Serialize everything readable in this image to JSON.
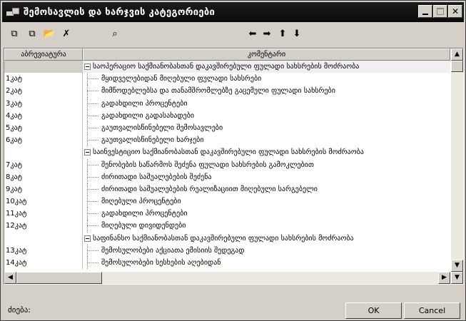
{
  "window": {
    "title": "შემოსავლის და ხარჯვის კატეგორიები",
    "minimize_label": "",
    "maximize_label": "",
    "close_label": "✕"
  },
  "toolbar": {
    "buttons": [
      {
        "name": "new-icon",
        "glyph": "⧉"
      },
      {
        "name": "edit-icon",
        "glyph": "⧉"
      },
      {
        "name": "open-folder-icon",
        "glyph": "📂"
      },
      {
        "name": "delete-icon",
        "glyph": "✗"
      },
      {
        "name": "find-icon",
        "glyph": "⌕"
      },
      {
        "name": "arrow-left-icon",
        "glyph": "⬅"
      },
      {
        "name": "arrow-right-icon",
        "glyph": "➡"
      },
      {
        "name": "arrow-up-icon",
        "glyph": "⬆"
      },
      {
        "name": "arrow-down-icon",
        "glyph": "⬇"
      }
    ]
  },
  "grid": {
    "columns": [
      "აბრევიატურა",
      "კომენტარი"
    ],
    "rows": [
      {
        "type": "group",
        "code": "",
        "name": "საოპერაციო საქმიანობასთან დაკავშირებული ფულადი სახსრების მოძრაობა",
        "selected": true
      },
      {
        "type": "child",
        "code": "1კატ",
        "name": "მყიდველებიდან მიღებული ფულადი სახსრები"
      },
      {
        "type": "child",
        "code": "2კატ",
        "name": "მიმწოდებლებსა და თანამშრომლებზე გაცემული ფულადი სახსრები"
      },
      {
        "type": "child",
        "code": "3კატ",
        "name": "გადახდილი პროცენტები"
      },
      {
        "type": "child",
        "code": "4კატ",
        "name": "გადახდილი გადასახადები"
      },
      {
        "type": "child",
        "code": "5კატ",
        "name": "გაუთვალისწინებელი შემოსავლები"
      },
      {
        "type": "child",
        "code": "6კატ",
        "name": "გაუთვალისწინებელი ხარჯები"
      },
      {
        "type": "group",
        "code": "",
        "name": "საინვესტიციო საქმიანობასთან დაკავშირებული ფულადი სახსრების მოძრაობა"
      },
      {
        "type": "child",
        "code": "7კატ",
        "name": "შენობების საწარმოს შეძენა ფულადი სახსრების გამოკლებით"
      },
      {
        "type": "child",
        "code": "8კატ",
        "name": "ძირითადი საშუალებების შეძენა"
      },
      {
        "type": "child",
        "code": "9კატ",
        "name": "ძირითადი საშუალებების რეალიზაციით მიღებული სარგებელი"
      },
      {
        "type": "child",
        "code": "10კატ",
        "name": "მიღებული პროცენტები"
      },
      {
        "type": "child",
        "code": "11კატ",
        "name": "გადახდილი პროცენტები"
      },
      {
        "type": "child",
        "code": "12კატ",
        "name": "მიღებული დივიდენდები"
      },
      {
        "type": "group",
        "code": "",
        "name": "საფინანსო საქმიანობასთან დაკავშირებული ფულადი სახსრების მოძრაობა"
      },
      {
        "type": "child",
        "code": "13კატ",
        "name": "შემოსულობები აქციათა ემისიის შედეგად"
      },
      {
        "type": "child",
        "code": "14კატ",
        "name": "შემოსულობები სესხების აღებიდან"
      }
    ]
  },
  "status": {
    "label": "ძიება:"
  },
  "buttons": {
    "ok": "OK",
    "cancel": "Cancel"
  }
}
